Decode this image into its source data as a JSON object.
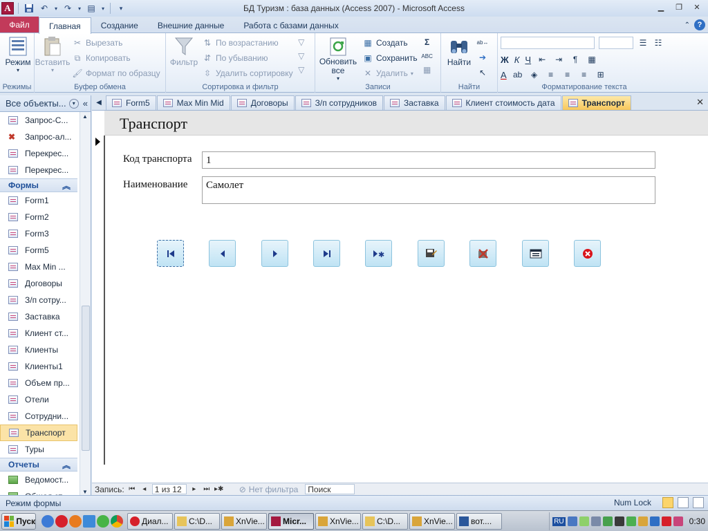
{
  "window": {
    "title": "БД Туризм : база данных (Access 2007)  -  Microsoft Access"
  },
  "ribbon_tabs": [
    {
      "label": "Файл"
    },
    {
      "label": "Главная"
    },
    {
      "label": "Создание"
    },
    {
      "label": "Внешние данные"
    },
    {
      "label": "Работа с базами данных"
    }
  ],
  "ribbon": {
    "views": {
      "mode_label": "Режим",
      "group_label": "Режимы"
    },
    "clipboard": {
      "paste_label": "Вставить",
      "cut_label": "Вырезать",
      "copy_label": "Копировать",
      "format_painter_label": "Формат по образцу",
      "group_label": "Буфер обмена"
    },
    "sort_filter": {
      "filter_label": "Фильтр",
      "ascending_label": "По возрастанию",
      "descending_label": "По убыванию",
      "remove_sort_label": "Удалить сортировку",
      "group_label": "Сортировка и фильтр"
    },
    "records": {
      "refresh_label": "Обновить все",
      "new_label": "Создать",
      "save_label": "Сохранить",
      "delete_label": "Удалить",
      "group_label": "Записи"
    },
    "find": {
      "find_label": "Найти",
      "group_label": "Найти"
    },
    "text_formatting": {
      "bold": "Ж",
      "italic": "К",
      "underline": "Ч",
      "font_color_label": "A",
      "group_label": "Форматирование текста"
    }
  },
  "nav_pane": {
    "header": "Все объекты...",
    "top_items": [
      {
        "label": "Запрос-С..."
      },
      {
        "label": "Запрос-ал..."
      },
      {
        "label": "Перекрес..."
      },
      {
        "label": "Перекрес..."
      }
    ],
    "forms_section": "Формы",
    "forms": [
      {
        "label": "Form1"
      },
      {
        "label": "Form2"
      },
      {
        "label": "Form3"
      },
      {
        "label": "Form5"
      },
      {
        "label": "Max Min ..."
      },
      {
        "label": "Договоры"
      },
      {
        "label": "З/п сотру..."
      },
      {
        "label": "Заставка"
      },
      {
        "label": "Клиент ст..."
      },
      {
        "label": "Клиенты"
      },
      {
        "label": "Клиенты1"
      },
      {
        "label": "Объем пр..."
      },
      {
        "label": "Отели"
      },
      {
        "label": "Сотрудни..."
      },
      {
        "label": "Транспорт",
        "selected": true
      },
      {
        "label": "Туры"
      }
    ],
    "reports_section": "Отчеты",
    "reports": [
      {
        "label": "Ведомост..."
      },
      {
        "label": "Общая ст..."
      }
    ]
  },
  "doc_tabs": [
    {
      "label": "Form5"
    },
    {
      "label": "Max Min Mid"
    },
    {
      "label": "Договоры"
    },
    {
      "label": "З/п сотрудников"
    },
    {
      "label": "Заставка"
    },
    {
      "label": "Клиент стоимость дата"
    },
    {
      "label": "Транспорт",
      "active": true
    }
  ],
  "form": {
    "title": "Транспорт",
    "fields": [
      {
        "label": "Код транспорта",
        "value": "1"
      },
      {
        "label": "Наименование",
        "value": "Самолет"
      }
    ],
    "nav_buttons": [
      {
        "icon": "first-record-icon"
      },
      {
        "icon": "previous-record-icon"
      },
      {
        "icon": "next-record-icon"
      },
      {
        "icon": "last-record-icon"
      },
      {
        "icon": "new-record-icon"
      },
      {
        "icon": "save-record-icon"
      },
      {
        "icon": "delete-record-icon"
      },
      {
        "icon": "open-form-icon"
      },
      {
        "icon": "close-form-icon"
      }
    ]
  },
  "record_nav": {
    "label": "Запись:",
    "position": "1 из 12",
    "filter_label": "Нет фильтра",
    "search_placeholder": "Поиск"
  },
  "status": {
    "mode": "Режим формы",
    "numlock": "Num Lock"
  },
  "taskbar": {
    "start_label": "Пуск",
    "buttons": [
      {
        "label": "Диал..."
      },
      {
        "label": "C:\\D..."
      },
      {
        "label": "XnVie..."
      },
      {
        "label": "Micr...",
        "active": true
      },
      {
        "label": "XnVie..."
      },
      {
        "label": "C:\\D..."
      },
      {
        "label": "XnVie..."
      },
      {
        "label": "вот...."
      }
    ],
    "language": "RU",
    "clock": "0:30"
  },
  "colors": {
    "accent": "#c23a5a",
    "active_tab": "#f7c75b",
    "ribbon_bg": "#dbe5f1"
  }
}
